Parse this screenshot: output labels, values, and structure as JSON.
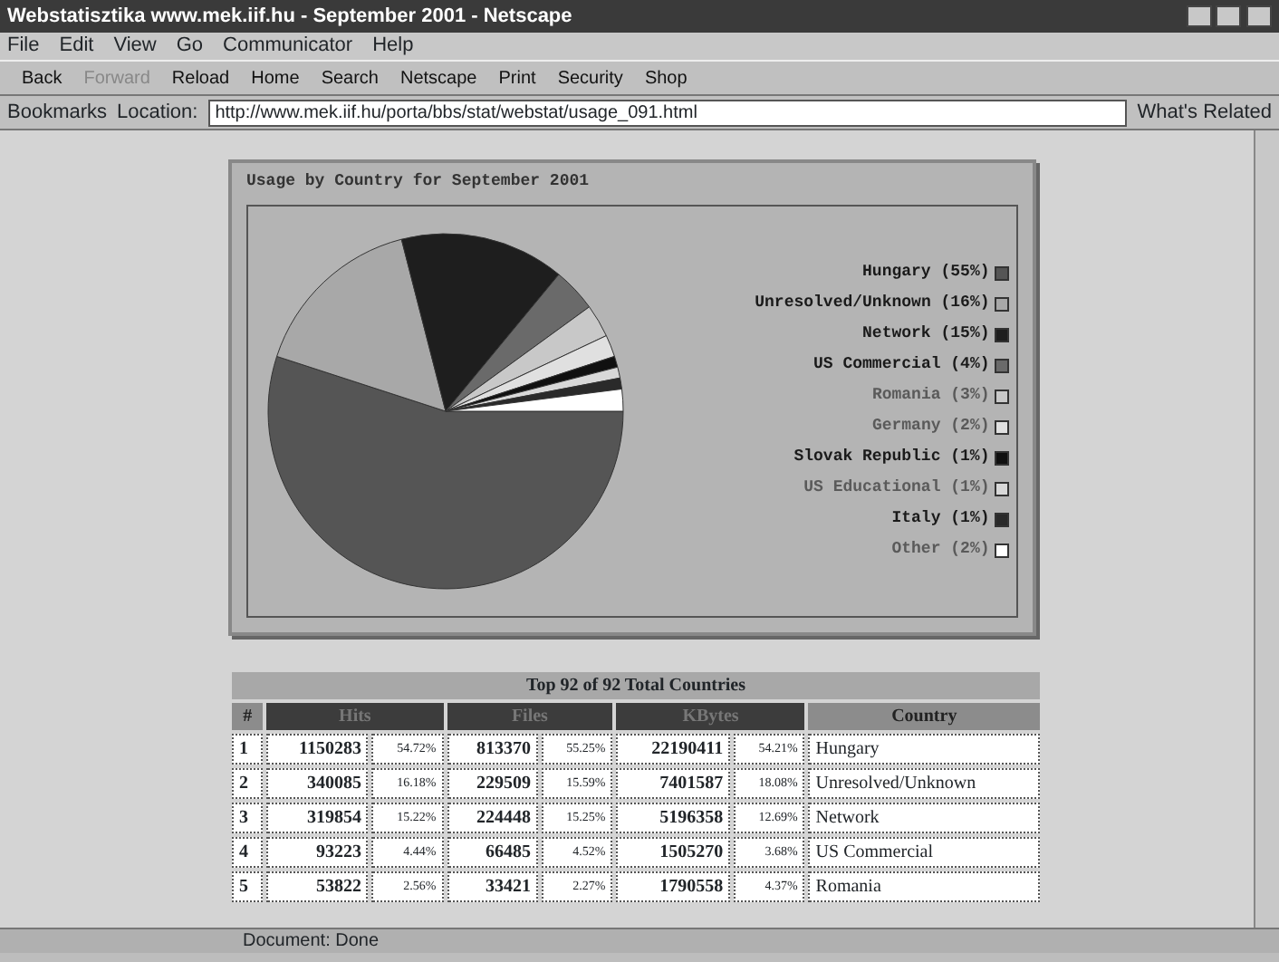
{
  "window": {
    "title": "Webstatisztika www.mek.iif.hu - September 2001 - Netscape"
  },
  "menu": [
    "File",
    "Edit",
    "View",
    "Go",
    "Communicator",
    "Help"
  ],
  "toolbar": [
    {
      "label": "Back",
      "disabled": false
    },
    {
      "label": "Forward",
      "disabled": true
    },
    {
      "label": "Reload",
      "disabled": false
    },
    {
      "label": "Home",
      "disabled": false
    },
    {
      "label": "Search",
      "disabled": false
    },
    {
      "label": "Netscape",
      "disabled": false
    },
    {
      "label": "Print",
      "disabled": false
    },
    {
      "label": "Security",
      "disabled": false
    },
    {
      "label": "Shop",
      "disabled": false
    }
  ],
  "location_bar": {
    "bookmarks": "Bookmarks",
    "label": "Location:",
    "url": "http://www.mek.iif.hu/porta/bbs/stat/webstat/usage_091.html",
    "related": "What's Related"
  },
  "chart_panel": {
    "chart_data": {
      "type": "pie",
      "title": "Usage by Country for September 2001",
      "categories": [
        "Hungary (55%)",
        "Unresolved/Unknown (16%)",
        "Network (15%)",
        "US Commercial (4%)",
        "Romania (3%)",
        "Germany (2%)",
        "Slovak Republic (1%)",
        "US Educational (1%)",
        "Italy (1%)",
        "Other (2%)"
      ],
      "values": [
        55,
        16,
        15,
        4,
        3,
        2,
        1,
        1,
        1,
        2
      ],
      "legend": "right",
      "colors": [
        "#555555",
        "#a8a8a8",
        "#1e1e1e",
        "#6a6a6a",
        "#c8c8c8",
        "#e0e0e0",
        "#101010",
        "#d8d8d8",
        "#2a2a2a",
        "#ffffff"
      ]
    }
  },
  "table": {
    "title": "Top 92 of 92 Total Countries",
    "columns": [
      "#",
      "Hits",
      "Files",
      "KBytes",
      "Country"
    ],
    "rows": [
      [
        "1",
        [
          "1150283",
          "54.72%"
        ],
        [
          "813370",
          "55.25%"
        ],
        [
          "22190411",
          "54.21%"
        ],
        "Hungary"
      ],
      [
        "2",
        [
          "340085",
          "16.18%"
        ],
        [
          "229509",
          "15.59%"
        ],
        [
          "7401587",
          "18.08%"
        ],
        "Unresolved/Unknown"
      ],
      [
        "3",
        [
          "319854",
          "15.22%"
        ],
        [
          "224448",
          "15.25%"
        ],
        [
          "5196358",
          "12.69%"
        ],
        "Network"
      ],
      [
        "4",
        [
          "93223",
          "4.44%"
        ],
        [
          "66485",
          "4.52%"
        ],
        [
          "1505270",
          "3.68%"
        ],
        "US Commercial"
      ],
      [
        "5",
        [
          "53822",
          "2.56%"
        ],
        [
          "33421",
          "2.27%"
        ],
        [
          "1790558",
          "4.37%"
        ],
        "Romania"
      ]
    ]
  },
  "status_bar": {
    "text": "Document: Done"
  }
}
